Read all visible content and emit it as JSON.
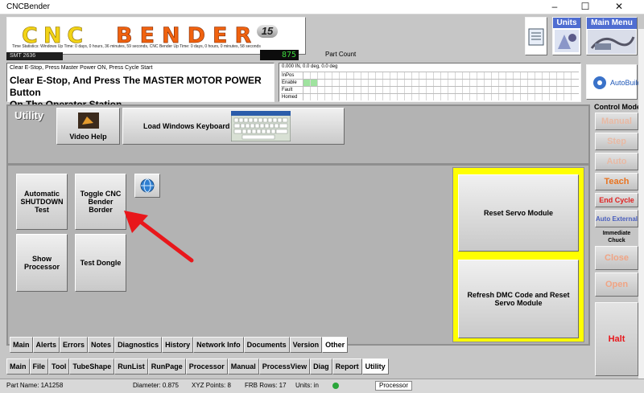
{
  "window": {
    "title": "CNCBender",
    "minimize": "–",
    "maximize": "☐",
    "close": "✕"
  },
  "header": {
    "logo_text": "CNC BENDER",
    "logo_version": "15",
    "stats_text": "Time Statistics: Windows Up Time: 0 days, 0 hours, 36 minutes, 59 seconds, CNC Bender Up Time: 0 days, 0 hours, 0 minutes, 58 seconds",
    "machine_id": "SMT 2636",
    "part_count_value": "875",
    "part_count_label": "Part Count",
    "msg_small": "Clear E-Stop,  Press Master Power ON, Press Cycle Start",
    "msg_line1": "Clear E-Stop, And Press The MASTER MOTOR POWER Button",
    "msg_line2": "On The Operator Station.",
    "status_head": "0.000 IN, 0.0 deg, 0.0 deg",
    "status_rows": [
      "InPos",
      "Enable",
      "Fault",
      "Homed"
    ],
    "units_label": "Units",
    "main_menu_label": "Main Menu",
    "autobuild_label": "AutoBuild"
  },
  "utility": {
    "title": "Utility",
    "video_help": "Video Help",
    "load_keyboard": "Load Windows Keyboard"
  },
  "buttons": {
    "auto_shutdown": "Automatic SHUTDOWN Test",
    "toggle_border": "Toggle CNC Bender Border",
    "show_processor": "Show Processor",
    "test_dongle": "Test Dongle",
    "reset_servo": "Reset Servo Module",
    "refresh_dmc": "Refresh DMC Code and Reset Servo Module"
  },
  "sub_tabs": [
    "Main",
    "Alerts",
    "Errors",
    "Notes",
    "Diagnostics",
    "History",
    "Network Info",
    "Documents",
    "Version",
    "Other"
  ],
  "sub_tab_active": 9,
  "main_tabs": [
    "Main",
    "File",
    "Tool",
    "TubeShape",
    "RunList",
    "RunPage",
    "Processor",
    "Manual",
    "ProcessView",
    "Diag",
    "Report",
    "Utility"
  ],
  "main_tab_active": 11,
  "control_mode": {
    "title": "Control Mode",
    "manual": "Manual",
    "step": "Step",
    "auto": "Auto",
    "teach": "Teach",
    "end_cycle": "End Cycle",
    "auto_external": "Auto External",
    "immediate_chuck": "Immediate Chuck",
    "close": "Close",
    "open": "Open",
    "halt": "Halt"
  },
  "statusbar": {
    "part_name": "Part Name: 1A1258",
    "diameter": "Diameter: 0.875",
    "xyz_points": "XYZ Points: 8",
    "frb_rows": "FRB Rows: 17",
    "units": "Units: in",
    "processor": "Processor"
  },
  "colors": {
    "highlight_yellow": "#ffff00",
    "arrow_red": "#e8171b",
    "teach_orange": "#e8731f",
    "end_cycle_red": "#e02020"
  }
}
